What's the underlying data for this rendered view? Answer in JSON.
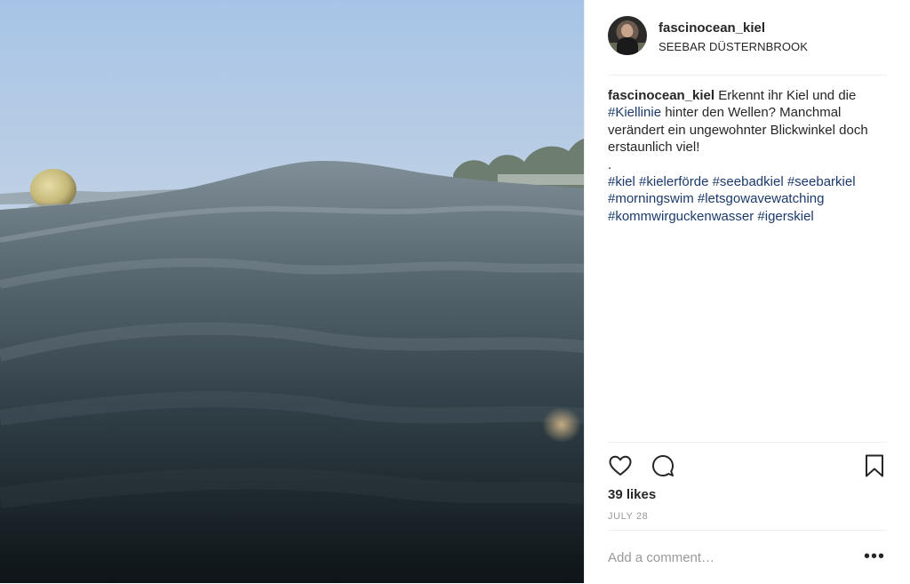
{
  "post": {
    "username": "fascinocean_kiel",
    "location": "SEEBAR DÜSTERNBROOK",
    "caption": {
      "username": "fascinocean_kiel",
      "text_1": " Erkennt ihr Kiel und die ",
      "tag_1": "#Kiellinie",
      "text_2": " hinter den Wellen? Manchmal verändert ein ungewohnter Blickwinkel doch erstaunlich viel!",
      "dot": ".",
      "hashtags": [
        "#kiel",
        "#kielerförde",
        "#seebadkiel",
        "#seebarkiel",
        "#morningswim",
        "#letsgowavewatching",
        "#kommwirguckenwasser",
        "#igerskiel"
      ]
    },
    "likes": "39 likes",
    "date": "JULY 28"
  },
  "comment_box": {
    "placeholder": "Add a comment…"
  },
  "more_label": "•••",
  "icons": {
    "like": "heart-icon",
    "comment": "comment-icon",
    "save": "bookmark-icon",
    "more": "more-options-icon"
  },
  "colors": {
    "text": "#262626",
    "hashtag": "#1b3a6b",
    "muted": "#999999",
    "divider": "#efefef"
  }
}
